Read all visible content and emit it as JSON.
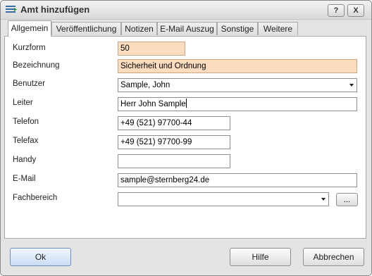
{
  "window": {
    "title": "Amt hinzufügen",
    "help_label": "?",
    "close_label": "X"
  },
  "tabs": [
    {
      "label": "Allgemein",
      "active": true
    },
    {
      "label": "Veröffentlichung",
      "active": false
    },
    {
      "label": "Notizen",
      "active": false
    },
    {
      "label": "E-Mail Auszug",
      "active": false
    },
    {
      "label": "Sonstige",
      "active": false
    },
    {
      "label": "Weitere",
      "active": false
    }
  ],
  "form": {
    "kurzform": {
      "label": "Kurzform",
      "value": "50"
    },
    "bezeichnung": {
      "label": "Bezeichnung",
      "value": "Sicherheit und Ordnung"
    },
    "benutzer": {
      "label": "Benutzer",
      "value": "Sample, John"
    },
    "leiter": {
      "label": "Leiter",
      "value": "Herr John Sample"
    },
    "telefon": {
      "label": "Telefon",
      "value": "+49 (521) 97700-44"
    },
    "telefax": {
      "label": "Telefax",
      "value": "+49 (521) 97700-99"
    },
    "handy": {
      "label": "Handy",
      "value": ""
    },
    "email": {
      "label": "E-Mail",
      "value": "sample@sternberg24.de"
    },
    "fachbereich": {
      "label": "Fachbereich",
      "value": "",
      "browse_label": "..."
    }
  },
  "buttons": {
    "ok": "Ok",
    "hilfe": "Hilfe",
    "abbrechen": "Abbrechen"
  },
  "colors": {
    "highlight_field": "#fbdcbf",
    "ok_button": "#c9dcf4"
  },
  "icons": {
    "app": "list-lines-icon",
    "dropdown": "chevron-down-icon"
  }
}
